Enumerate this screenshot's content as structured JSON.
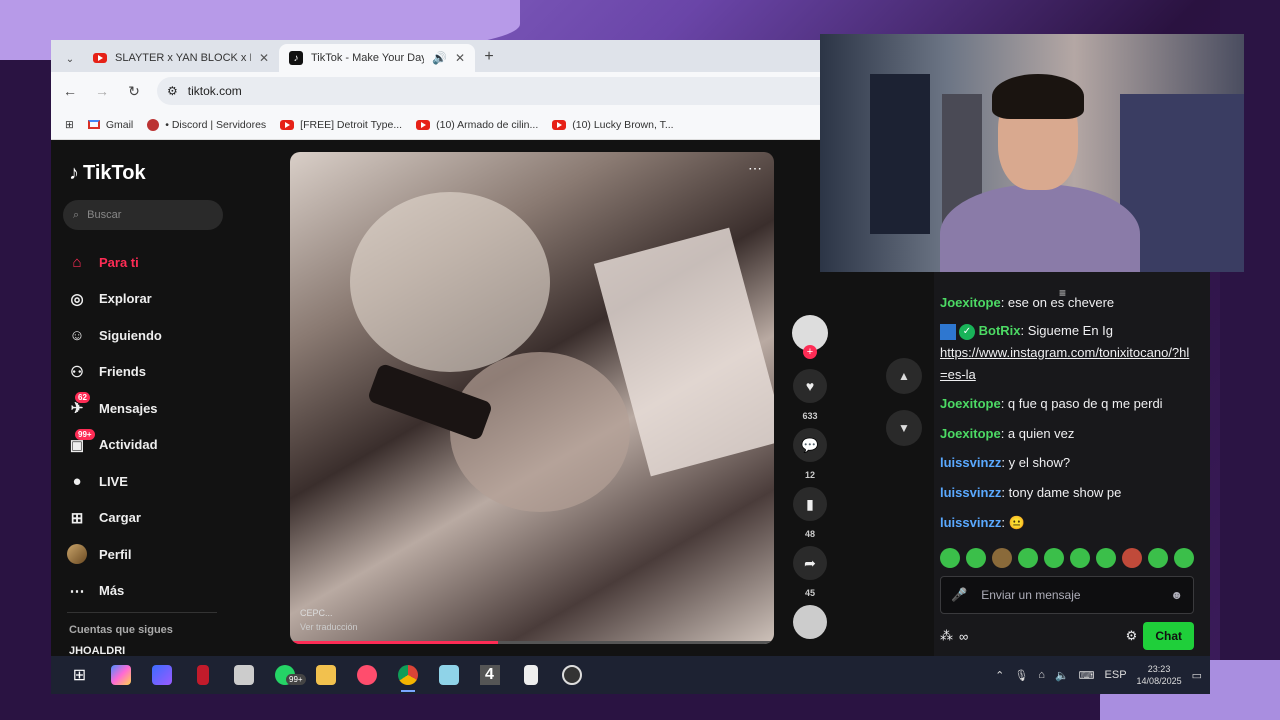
{
  "browser": {
    "tabs": [
      {
        "title": "SLAYTER x YAN BLOCK x NTG -",
        "icon": "youtube-icon",
        "active": false
      },
      {
        "title": "TikTok - Make Your Day",
        "icon": "tiktok-icon",
        "active": true
      }
    ],
    "url": "tiktok.com",
    "bookmarks": [
      {
        "label": "Gmail",
        "icon": "gmail-icon"
      },
      {
        "label": "• Discord | Servidores",
        "icon": "discord-icon"
      },
      {
        "label": "[FREE] Detroit Type...",
        "icon": "youtube-icon"
      },
      {
        "label": "(10) Armado de cilin...",
        "icon": "youtube-icon"
      },
      {
        "label": "(10) Lucky Brown, T...",
        "icon": "youtube-icon"
      }
    ]
  },
  "tiktok": {
    "logo_text": "TikTok",
    "search_placeholder": "Buscar",
    "nav": [
      {
        "label": "Para ti",
        "icon": "home-icon",
        "active": true
      },
      {
        "label": "Explorar",
        "icon": "compass-icon"
      },
      {
        "label": "Siguiendo",
        "icon": "following-icon"
      },
      {
        "label": "Friends",
        "icon": "friends-icon"
      },
      {
        "label": "Mensajes",
        "icon": "messages-icon",
        "badge": "62"
      },
      {
        "label": "Actividad",
        "icon": "activity-icon",
        "badge": "99+"
      },
      {
        "label": "LIVE",
        "icon": "live-icon"
      },
      {
        "label": "Cargar",
        "icon": "upload-icon"
      },
      {
        "label": "Perfil",
        "icon": "profile-avatar"
      },
      {
        "label": "Más",
        "icon": "more-icon"
      }
    ],
    "following_title": "Cuentas que sigues",
    "following_user": "JHOALDRI",
    "video": {
      "caption": "CEPC...",
      "sub": "Ver traducción",
      "progress": 0.43
    },
    "actions": {
      "likes": "633",
      "comments": "12",
      "saves": "48",
      "shares": "45"
    }
  },
  "chat": {
    "messages": [
      {
        "user": "Joexitope",
        "color": "green",
        "text": ": ese on es chevere"
      },
      {
        "user": "BotRix",
        "color": "green",
        "text": ": Sigueme En Ig",
        "link": "https://www.instagram.com/tonixitocano/?hl=es-la",
        "bot": true
      },
      {
        "user": "Joexitope",
        "color": "green",
        "text": ": q fue q paso de q me perdi"
      },
      {
        "user": "Joexitope",
        "color": "green",
        "text": ": a quien vez"
      },
      {
        "user": "luissvinzz",
        "color": "blue",
        "text": ": y el show?"
      },
      {
        "user": "luissvinzz",
        "color": "blue",
        "text": ": tony dame show pe"
      },
      {
        "user": "luissvinzz",
        "color": "blue",
        "text": ": 😐"
      }
    ],
    "input_placeholder": "Enviar un mensaje",
    "chat_button": "Chat",
    "points_label": "∞"
  },
  "taskbar": {
    "whatsapp_badge": "99+",
    "lang": "ESP",
    "time": "23:23",
    "date": "14/08/2025"
  }
}
